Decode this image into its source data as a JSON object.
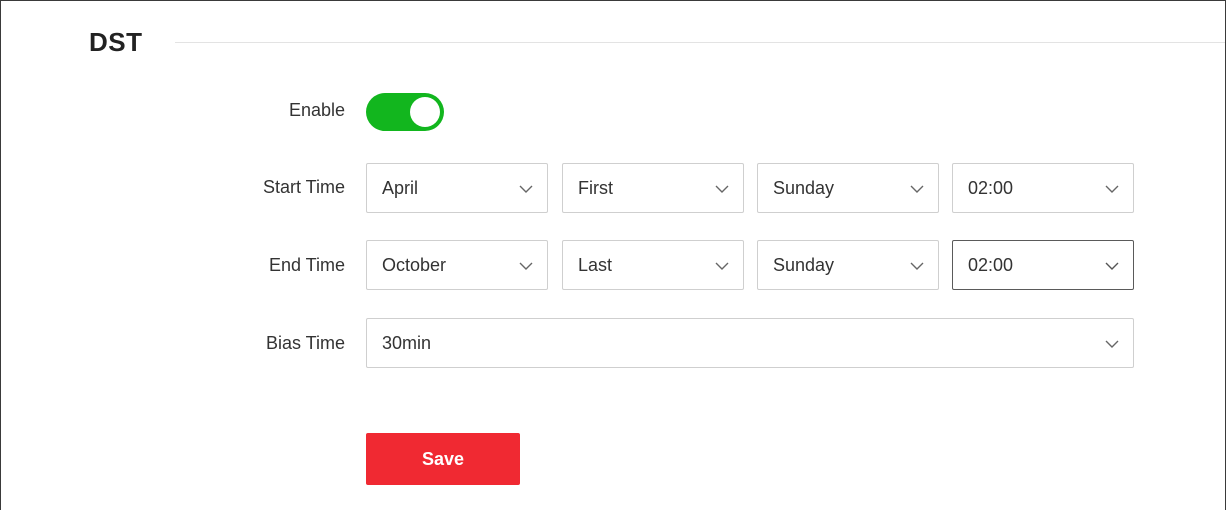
{
  "section": {
    "title": "DST"
  },
  "enable": {
    "label": "Enable",
    "on": true,
    "color": "#12b61e"
  },
  "start_time": {
    "label": "Start Time",
    "month": "April",
    "week": "First",
    "day": "Sunday",
    "time": "02:00"
  },
  "end_time": {
    "label": "End Time",
    "month": "October",
    "week": "Last",
    "day": "Sunday",
    "time": "02:00"
  },
  "bias_time": {
    "label": "Bias Time",
    "value": "30min"
  },
  "save": {
    "label": "Save",
    "color": "#f02932"
  },
  "icons": {
    "dropdown": "chevron-down-icon"
  }
}
